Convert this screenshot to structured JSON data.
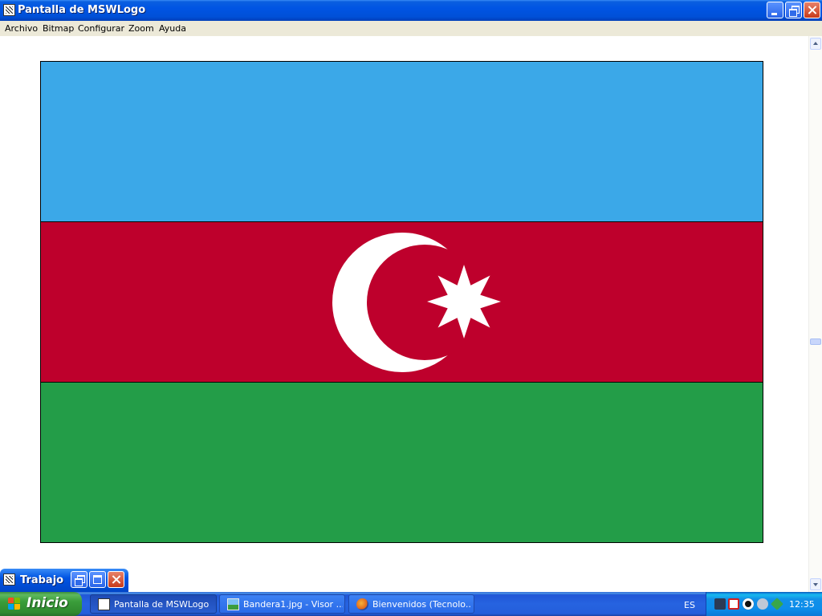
{
  "window": {
    "title": "Pantalla de MSWLogo",
    "icon": "mswlogo-icon"
  },
  "menu": {
    "items": [
      "Archivo",
      "Bitmap",
      "Configurar",
      "Zoom",
      "Ayuda"
    ]
  },
  "flag": {
    "stripes": [
      {
        "name": "blue",
        "color": "#3ba8e8"
      },
      {
        "name": "red",
        "color": "#be002c"
      },
      {
        "name": "green",
        "color": "#239d48"
      }
    ],
    "emblem_color": "#ffffff"
  },
  "minimized_window": {
    "title": "Trabajo"
  },
  "taskbar": {
    "start_label": "Inicio",
    "tasks": [
      {
        "label": "Pantalla de MSWLogo",
        "icon": "mswlogo-icon",
        "active": true
      },
      {
        "label": "Bandera1.jpg - Visor ...",
        "icon": "image-viewer-icon",
        "active": false
      },
      {
        "label": "Bienvenidos (Tecnolo...",
        "icon": "firefox-icon",
        "active": false
      }
    ],
    "language": "ES",
    "clock": "12:35"
  }
}
